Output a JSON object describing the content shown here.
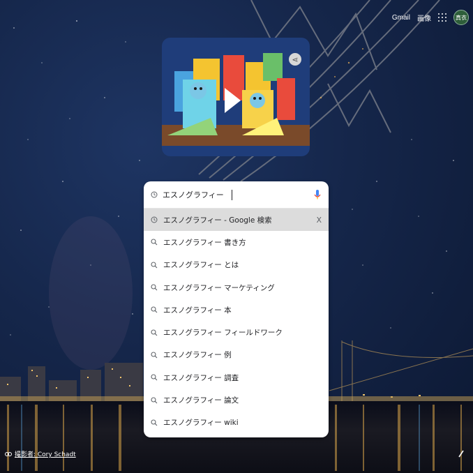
{
  "topbar": {
    "gmail": "Gmail",
    "images": "画像",
    "avatar_text": "真衣"
  },
  "doodle": {
    "letters": [
      "G",
      "o",
      "o",
      "g",
      "l",
      "e"
    ],
    "share_icon": "share-icon"
  },
  "search": {
    "query": "エスノグラフィー",
    "suggestions": [
      {
        "text": "エスノグラフィー - Google 検索",
        "type": "history",
        "highlighted": true,
        "remove": "X"
      },
      {
        "text": "エスノグラフィー 書き方",
        "type": "search"
      },
      {
        "text": "エスノグラフィー とは",
        "type": "search"
      },
      {
        "text": "エスノグラフィー マーケティング",
        "type": "search"
      },
      {
        "text": "エスノグラフィー 本",
        "type": "search"
      },
      {
        "text": "エスノグラフィー フィールドワーク",
        "type": "search"
      },
      {
        "text": "エスノグラフィー 例",
        "type": "search"
      },
      {
        "text": "エスノグラフィー 調査",
        "type": "search"
      },
      {
        "text": "エスノグラフィー 論文",
        "type": "search"
      },
      {
        "text": "エスノグラフィー wiki",
        "type": "search"
      }
    ]
  },
  "credit": {
    "text": "撮影者: Cory Schadt"
  },
  "colors": {
    "sky": "#15264a",
    "highlight": "#dcdcdc",
    "doodle_bg": "#1f3d7a",
    "mic_blue": "#4285f4",
    "mic_red": "#ea4335"
  }
}
